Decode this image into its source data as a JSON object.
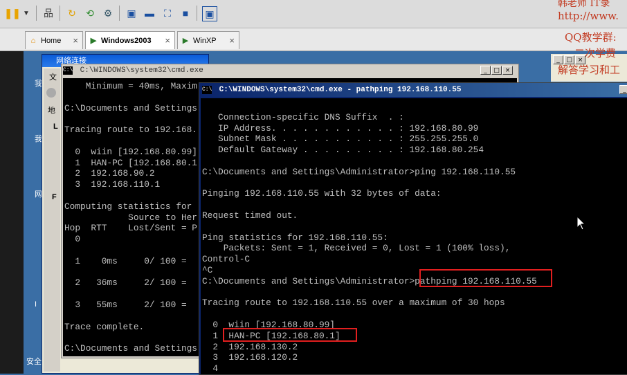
{
  "host": {
    "watermark_line1": "韩老师 IT录",
    "watermark_line2": "http://www.",
    "qq_label": "QQ教学群:",
    "toolbar_icons": [
      "pause-icon",
      "dropdown-icon",
      "network-icon",
      "snapshot-icon",
      "revert-icon",
      "manage-snapshots-icon",
      "console-view-icon",
      "quick-switch-icon",
      "fullscreen-icon",
      "unity-icon",
      "view-icon"
    ]
  },
  "tabs": [
    {
      "label": "Home",
      "icon": "home-icon",
      "close": "×"
    },
    {
      "label": "Windows2003",
      "icon": "vm-icon",
      "close": "×"
    },
    {
      "label": "WinXP",
      "icon": "vm-icon",
      "close": "×"
    }
  ],
  "explorer": {
    "title": "网络连接",
    "side_labels": [
      "文",
      "地",
      "L",
      "我",
      "网",
      "F",
      "I",
      "E"
    ],
    "desktop_labels": [
      "我",
      "我",
      "网",
      "I",
      "安全"
    ]
  },
  "right_window": {
    "line1": "二次学费",
    "line2": "解答学习和工"
  },
  "cmd1": {
    "title": "C:\\WINDOWS\\system32\\cmd.exe",
    "min": "_",
    "max": "□",
    "close": "×",
    "lines": [
      "    Minimum = 40ms, Maxim",
      "",
      "C:\\Documents and Settings",
      "",
      "Tracing route to 192.168.",
      "",
      "  0  wiin [192.168.80.99]",
      "  1  HAN-PC [192.168.80.1",
      "  2  192.168.90.2",
      "  3  192.168.110.1",
      "",
      "Computing statistics for",
      "            Source to Her",
      "Hop  RTT    Lost/Sent = P",
      "  0",
      "",
      "  1    0ms     0/ 100 =",
      "",
      "  2   36ms     2/ 100 =",
      "",
      "  3   55ms     2/ 100 =",
      "",
      "Trace complete.",
      "",
      "C:\\Documents and Settings"
    ]
  },
  "cmd2": {
    "title": "C:\\WINDOWS\\system32\\cmd.exe - pathping 192.168.110.55",
    "lines": [
      "",
      "   Connection-specific DNS Suffix  . :",
      "   IP Address. . . . . . . . . . . . : 192.168.80.99",
      "   Subnet Mask . . . . . . . . . . . : 255.255.255.0",
      "   Default Gateway . . . . . . . . . : 192.168.80.254",
      "",
      "C:\\Documents and Settings\\Administrator>ping 192.168.110.55",
      "",
      "Pinging 192.168.110.55 with 32 bytes of data:",
      "",
      "Request timed out.",
      "",
      "Ping statistics for 192.168.110.55:",
      "    Packets: Sent = 1, Received = 0, Lost = 1 (100% loss),",
      "Control-C",
      "^C",
      "C:\\Documents and Settings\\Administrator>pathping 192.168.110.55",
      "",
      "Tracing route to 192.168.110.55 over a maximum of 30 hops",
      "",
      "  0  wiin [192.168.80.99]",
      "  1  HAN-PC [192.168.80.1]",
      "  2  192.168.130.2",
      "  3  192.168.120.2",
      "  4"
    ]
  },
  "colors": {
    "desktop": "#3a6ea5",
    "console_text": "#c0c0c0",
    "highlight": "#e21f1f",
    "watermark": "#c23b22"
  }
}
